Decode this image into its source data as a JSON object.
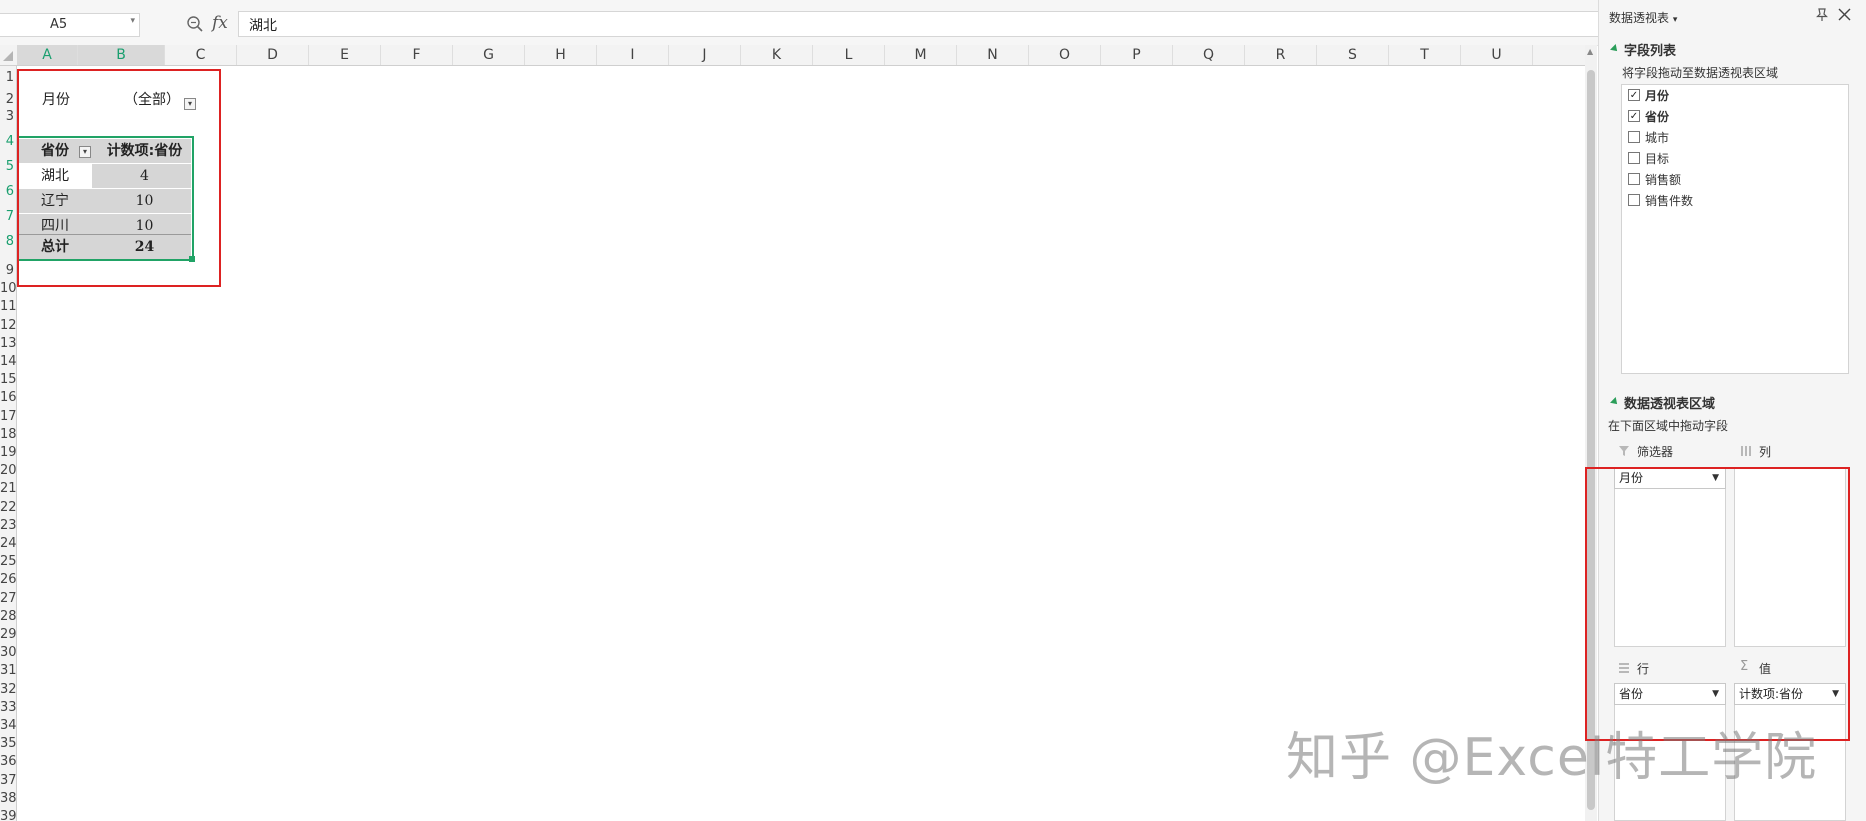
{
  "formula_bar": {
    "name_box": "A5",
    "fx_label": "fx",
    "formula_value": "湖北"
  },
  "sheet": {
    "columns": [
      "A",
      "B",
      "C",
      "D",
      "E",
      "F",
      "G",
      "H",
      "I",
      "J",
      "K",
      "L",
      "M",
      "N",
      "O",
      "P",
      "Q",
      "R",
      "S",
      "T",
      "U"
    ],
    "selected_columns": [
      "A",
      "B"
    ],
    "row_numbers": [
      "1",
      "2",
      "3",
      "4",
      "5",
      "6",
      "7",
      "8",
      "9",
      "10",
      "11",
      "12",
      "13",
      "14",
      "15",
      "16",
      "17",
      "18",
      "19",
      "20",
      "21",
      "22",
      "23",
      "24",
      "25",
      "26",
      "27",
      "28",
      "29",
      "30",
      "31",
      "32",
      "33",
      "34",
      "35",
      "36",
      "37",
      "38",
      "39"
    ],
    "selected_rows": [
      "4",
      "5",
      "6",
      "7",
      "8"
    ]
  },
  "pivot": {
    "filter_field": "月份",
    "filter_value": "（全部）",
    "row_header": "省份",
    "value_header": "计数项:省份",
    "rows": [
      {
        "label": "湖北",
        "value": "4"
      },
      {
        "label": "辽宁",
        "value": "10"
      },
      {
        "label": "四川",
        "value": "10"
      }
    ],
    "total_label": "总计",
    "total_value": "24"
  },
  "pane": {
    "title": "数据透视表",
    "title_caret": "▾",
    "field_list_title": "字段列表",
    "field_list_hint": "将字段拖动至数据透视表区域",
    "fields": [
      {
        "label": "月份",
        "checked": true
      },
      {
        "label": "省份",
        "checked": true
      },
      {
        "label": "城市",
        "checked": false
      },
      {
        "label": "目标",
        "checked": false
      },
      {
        "label": "销售额",
        "checked": false
      },
      {
        "label": "销售件数",
        "checked": false
      }
    ],
    "areas_title": "数据透视表区域",
    "areas_hint": "在下面区域中拖动字段",
    "filter_area": {
      "label": "筛选器",
      "chip": "月份"
    },
    "column_area": {
      "label": "列"
    },
    "row_area": {
      "label": "行",
      "chip": "省份"
    },
    "value_area": {
      "label": "值",
      "chip": "计数项:省份"
    }
  },
  "watermark": "知乎 @Excel特工学院",
  "colors": {
    "selection_green": "#21a366",
    "highlight_red": "#dd2222",
    "pivot_gray": "#d6d6d6"
  }
}
